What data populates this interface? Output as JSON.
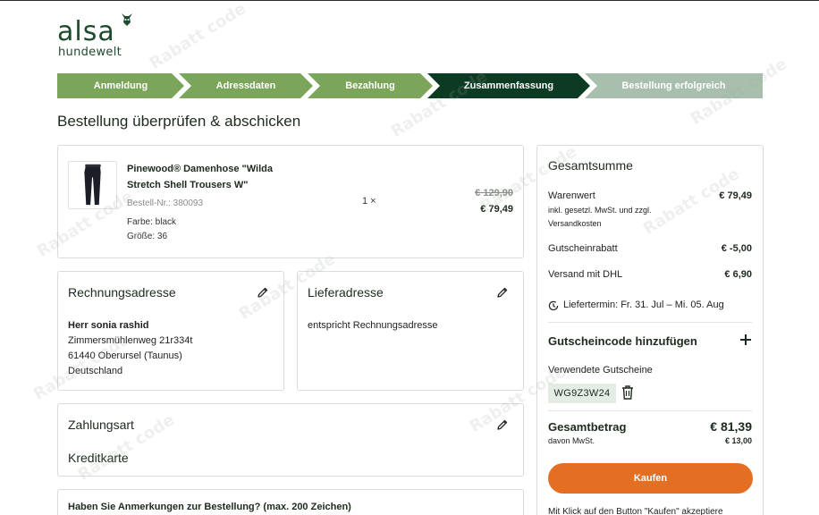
{
  "brand": {
    "name": "alsa",
    "sub": "hundewelt"
  },
  "steps": [
    {
      "label": "Anmeldung",
      "state": "done"
    },
    {
      "label": "Adressdaten",
      "state": "done"
    },
    {
      "label": "Bezahlung",
      "state": "done"
    },
    {
      "label": "Zusammenfassung",
      "state": "active"
    },
    {
      "label": "Bestellung erfolgreich",
      "state": "future"
    }
  ],
  "page_title": "Bestellung überprüfen & abschicken",
  "product": {
    "name": "Pinewood® Damenhose \"Wilda Stretch Shell Trousers W\"",
    "sku": "Bestell-Nr.: 380093",
    "color": "Farbe: black",
    "size": "Größe: 36",
    "qty": "1 ×",
    "old_price": "€ 129,90",
    "price": "€ 79,49"
  },
  "billing": {
    "title": "Rechnungsadresse",
    "name": "Herr sonia rashid",
    "street": "Zimmersmühlenweg 21r334t",
    "city": "61440 Oberursel (Taunus)",
    "country": "Deutschland"
  },
  "shipping": {
    "title": "Lieferadresse",
    "text": "entspricht Rechnungsadresse"
  },
  "payment": {
    "title": "Zahlungsart",
    "method": "Kreditkarte"
  },
  "remarks": {
    "title": "Haben Sie Anmerkungen zur Bestellung? (max. 200 Zeichen)"
  },
  "summary": {
    "title": "Gesamtsumme",
    "goods_label": "Warenwert",
    "goods_note": "inkl. gesetzl. MwSt. und zzgl. Versandkosten",
    "goods_value": "€ 79,49",
    "voucher_label": "Gutscheinrabatt",
    "voucher_value": "€ -5,00",
    "shipping_label": "Versand mit DHL",
    "shipping_value": "€ 6,90",
    "delivery": "Liefertermin: Fr. 31. Jul – Mi. 05. Aug",
    "add_voucher": "Gutscheincode hinzufügen",
    "used_vouchers": "Verwendete Gutscheine",
    "voucher_code": "WG9Z3W24",
    "total_label": "Gesamtbetrag",
    "total_value": "€ 81,39",
    "tax_label": "davon MwSt.",
    "tax_value": "€ 13,00",
    "buy": "Kaufen",
    "legal": "Mit Klick auf den Button \"Kaufen\" akzeptiere"
  },
  "watermark": "Rabatt code",
  "colors": {
    "brand_green": "#1f4a2d",
    "step_done": "#7aa55a",
    "step_active": "#0c3a22",
    "step_future": "#a9bfad",
    "buy_button": "#e46e22"
  }
}
